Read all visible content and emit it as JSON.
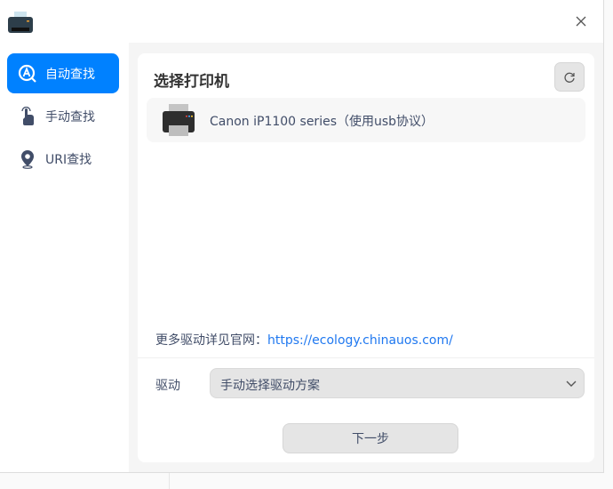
{
  "sidebar": {
    "items": [
      {
        "label": "自动查找",
        "icon": "auto-search-icon",
        "active": true
      },
      {
        "label": "手动查找",
        "icon": "hand-pointer-icon"
      },
      {
        "label": "URI查找",
        "icon": "location-pin-icon"
      }
    ]
  },
  "main": {
    "title": "选择打印机",
    "printers": [
      {
        "name": "Canon iP1100 series（使用usb协议）"
      }
    ],
    "more_label": "更多驱动详见官网：",
    "more_link": "https://ecology.chinauos.com/",
    "driver_label": "驱动",
    "driver_value": "手动选择驱动方案",
    "next_label": "下一步"
  },
  "colors": {
    "accent": "#0081ff",
    "link": "#1f78f0"
  }
}
